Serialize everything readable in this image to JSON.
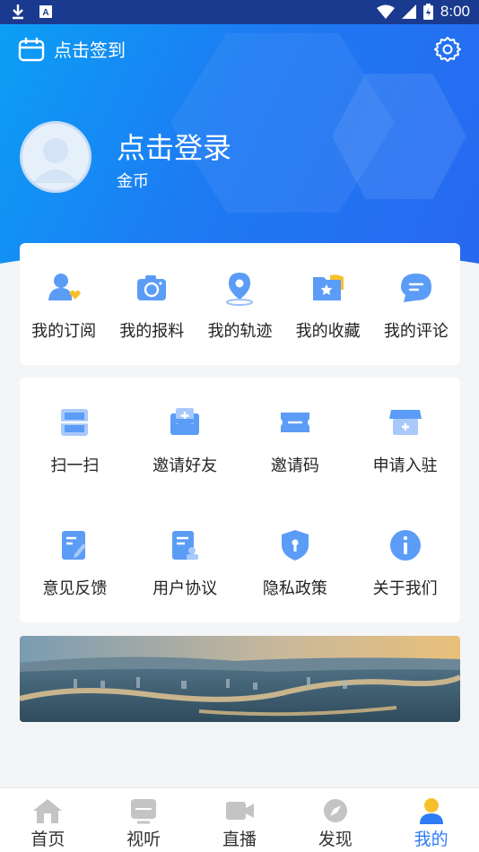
{
  "status_bar": {
    "time": "8:00"
  },
  "header": {
    "checkin_label": "点击签到",
    "login_title": "点击登录",
    "coins_label": "金币"
  },
  "quick_actions": [
    {
      "label": "我的订阅",
      "icon": "subscribe-icon"
    },
    {
      "label": "我的报料",
      "icon": "camera-icon"
    },
    {
      "label": "我的轨迹",
      "icon": "location-pin-icon"
    },
    {
      "label": "我的收藏",
      "icon": "favorites-folder-icon"
    },
    {
      "label": "我的评论",
      "icon": "comment-bubble-icon"
    }
  ],
  "services": [
    {
      "label": "扫一扫",
      "icon": "scan-icon"
    },
    {
      "label": "邀请好友",
      "icon": "invite-envelope-icon"
    },
    {
      "label": "邀请码",
      "icon": "ticket-icon"
    },
    {
      "label": "申请入驻",
      "icon": "store-icon"
    },
    {
      "label": "意见反馈",
      "icon": "feedback-icon"
    },
    {
      "label": "用户协议",
      "icon": "agreement-icon"
    },
    {
      "label": "隐私政策",
      "icon": "shield-icon"
    },
    {
      "label": "关于我们",
      "icon": "info-icon"
    }
  ],
  "tabs": [
    {
      "label": "首页",
      "icon": "home-icon",
      "active": false
    },
    {
      "label": "视听",
      "icon": "tv-icon",
      "active": false
    },
    {
      "label": "直播",
      "icon": "video-camera-icon",
      "active": false
    },
    {
      "label": "发现",
      "icon": "compass-icon",
      "active": false
    },
    {
      "label": "我的",
      "icon": "user-icon",
      "active": true
    }
  ],
  "colors": {
    "accent": "#2e7cf6",
    "hero_start": "#0b9ff5",
    "hero_end": "#2868f0",
    "icon_blue": "#5b9cf7",
    "icon_yellow": "#f7c02b"
  }
}
